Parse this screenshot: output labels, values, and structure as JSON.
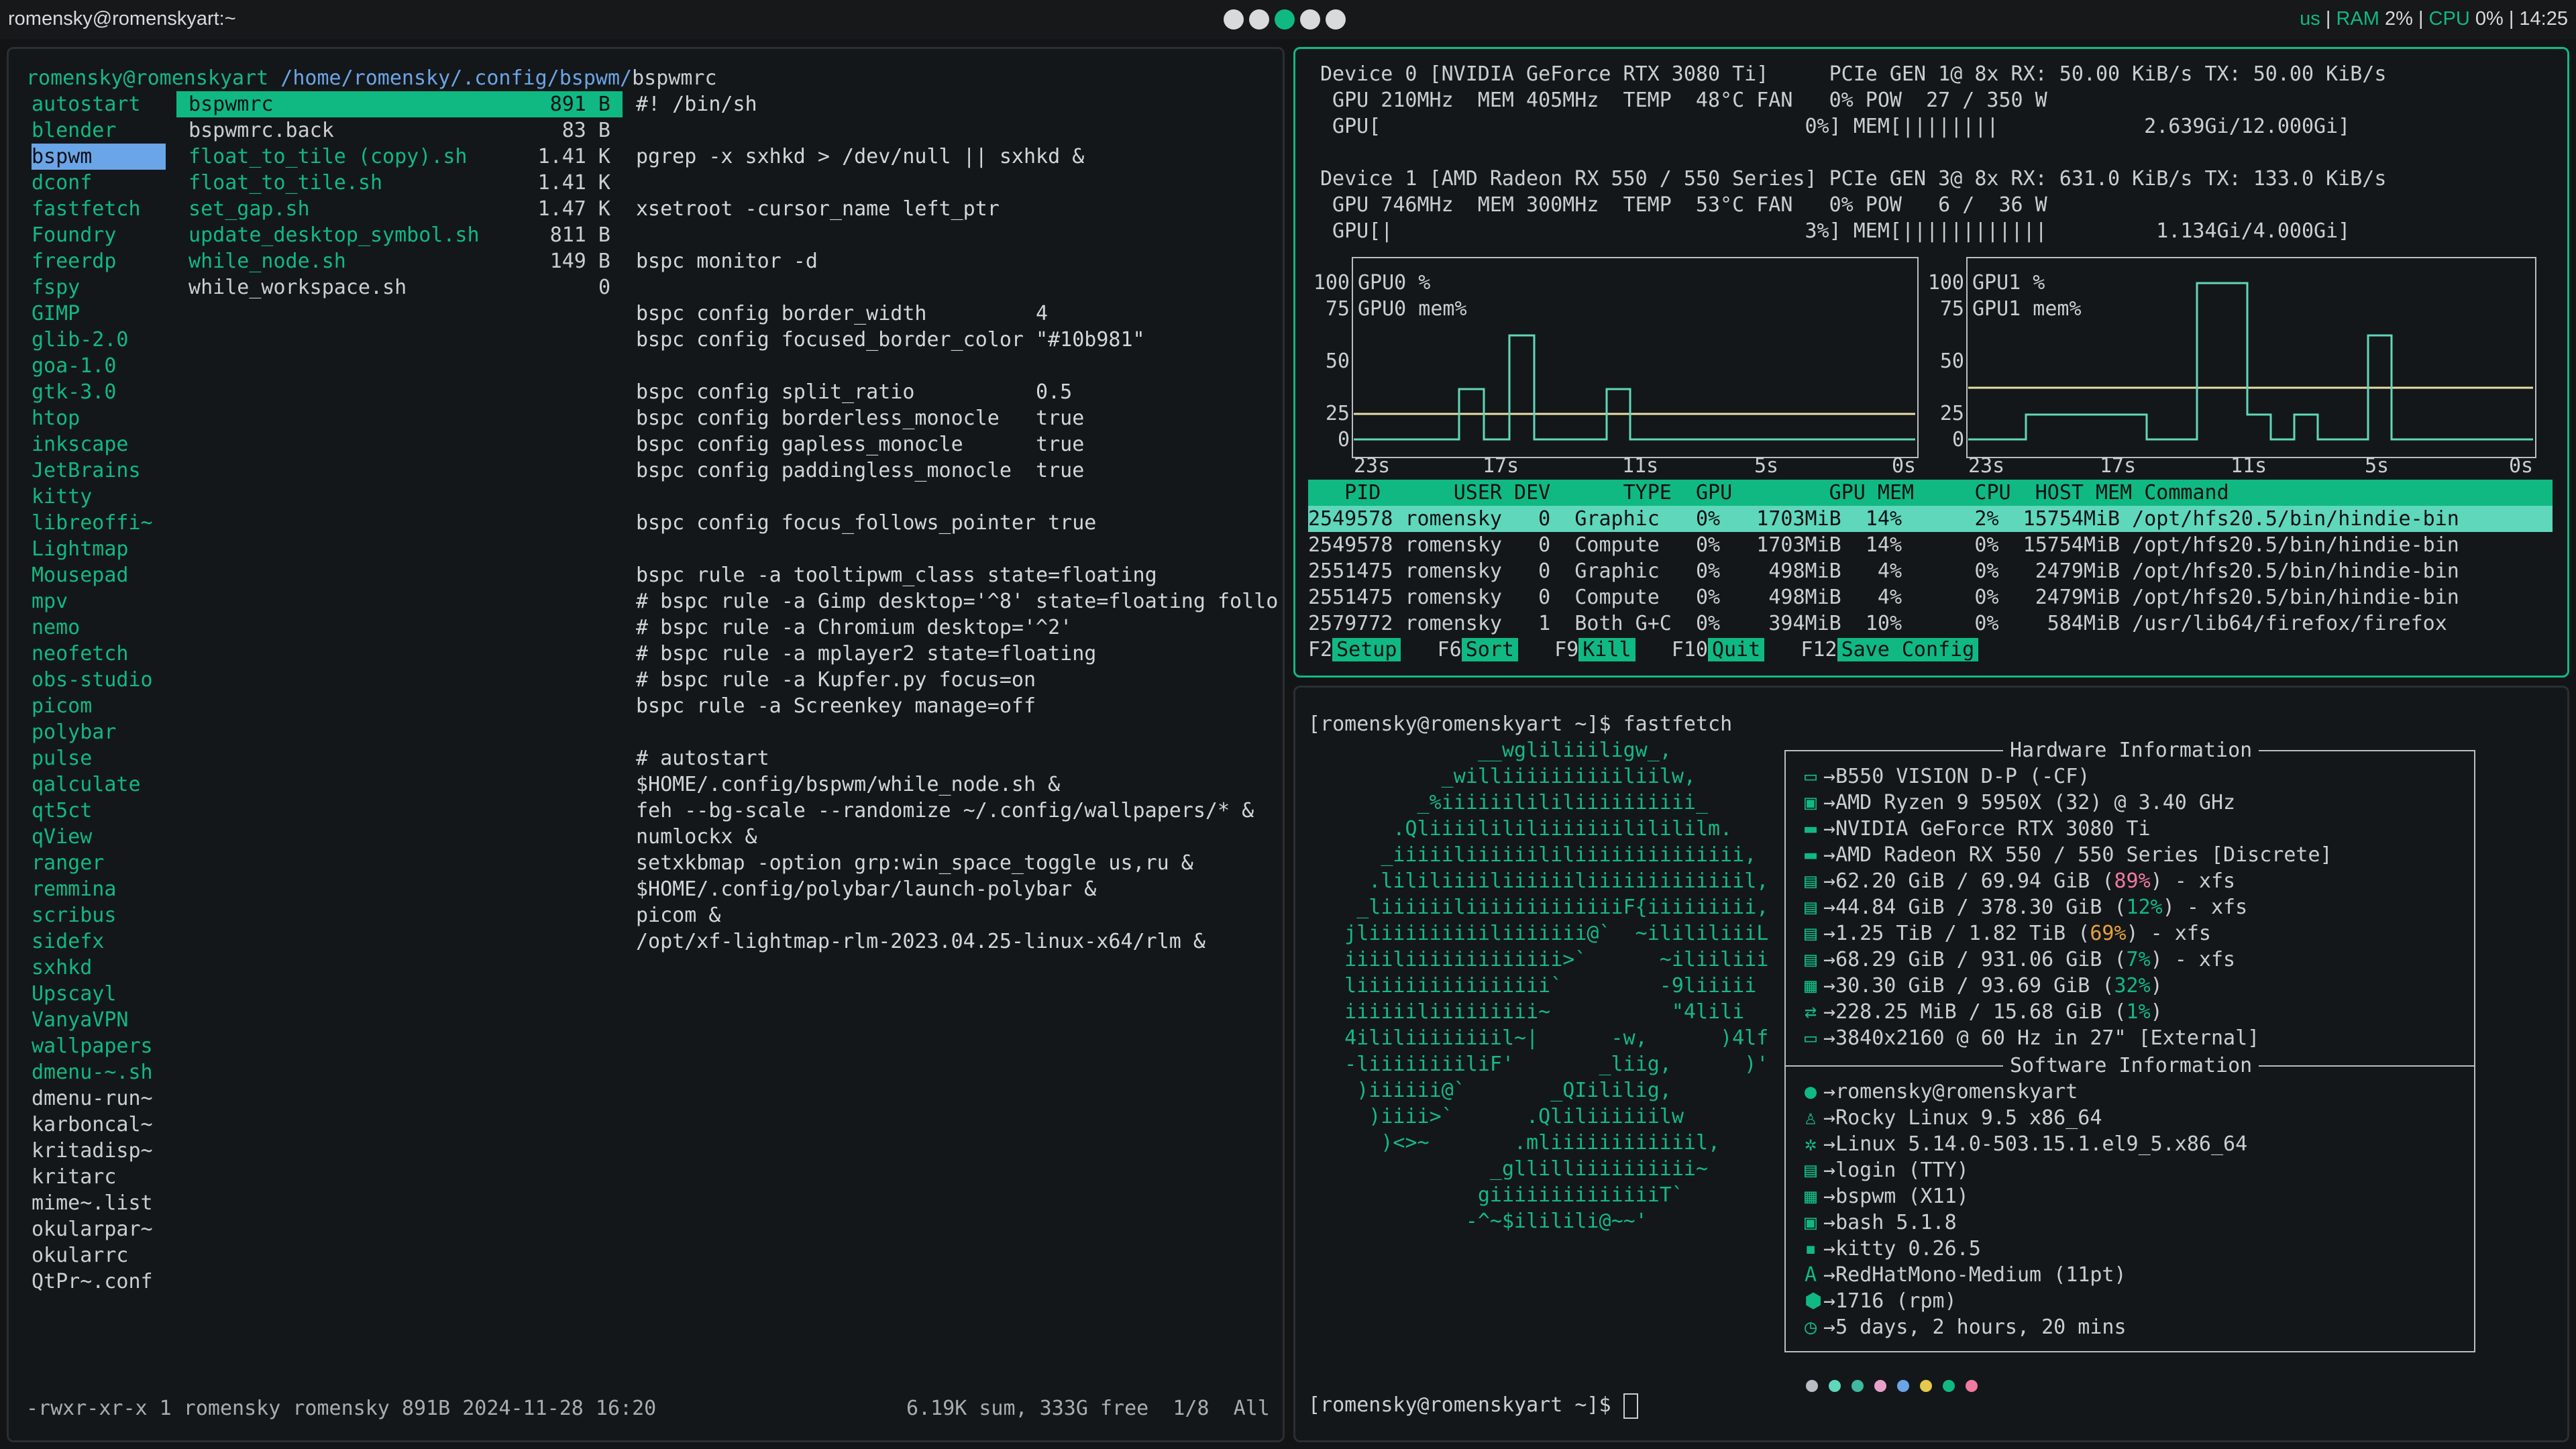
{
  "topbar": {
    "window_title": "romensky@romenskyart:~",
    "layout": "us",
    "ram_label": "RAM",
    "ram_value": "2%",
    "cpu_label": "CPU",
    "cpu_value": "0%",
    "clock": "14:25",
    "workspaces": [
      "1",
      "2",
      "3",
      "4",
      "5"
    ],
    "active_workspace": "3"
  },
  "ranger": {
    "path_user": "romensky@romenskyart",
    "path_dir": "/home/romensky/.config/bspwm/",
    "path_file": "bspwmrc",
    "dirs": [
      "autostart",
      "blender",
      "bspwm",
      "dconf",
      "fastfetch",
      "Foundry",
      "freerdp",
      "fspy",
      "GIMP",
      "glib-2.0",
      "goa-1.0",
      "gtk-3.0",
      "htop",
      "inkscape",
      "JetBrains",
      "kitty",
      "libreoffi~",
      "Lightmap",
      "Mousepad",
      "mpv",
      "nemo",
      "neofetch",
      "obs-studio",
      "picom",
      "polybar",
      "pulse",
      "qalculate",
      "qt5ct",
      "qView",
      "ranger",
      "remmina",
      "scribus",
      "sidefx",
      "sxhkd",
      "Upscayl",
      "VanyaVPN",
      "wallpapers",
      "dmenu-~.sh",
      "dmenu-run~",
      "karboncal~",
      "kritadisp~",
      "kritarc",
      "mime~.list",
      "okularpar~",
      "okularrc",
      "QtPr~.conf"
    ],
    "files": [
      {
        "name": "bspwmrc",
        "size": "891 B"
      },
      {
        "name": "bspwmrc.back",
        "size": "83 B"
      },
      {
        "name": "float_to_tile (copy).sh",
        "size": "1.41 K"
      },
      {
        "name": "float_to_tile.sh",
        "size": "1.41 K"
      },
      {
        "name": "set_gap.sh",
        "size": "1.47 K"
      },
      {
        "name": "update_desktop_symbol.sh",
        "size": "811 B"
      },
      {
        "name": "while_node.sh",
        "size": "149 B"
      },
      {
        "name": "while_workspace.sh",
        "size": "0"
      }
    ],
    "preview": [
      "#! /bin/sh",
      "",
      "pgrep -x sxhkd > /dev/null || sxhkd &",
      "",
      "xsetroot -cursor_name left_ptr",
      "",
      "bspc monitor -d",
      "",
      "bspc config border_width         4",
      "bspc config focused_border_color \"#10b981\"",
      "",
      "bspc config split_ratio          0.5",
      "bspc config borderless_monocle   true",
      "bspc config gapless_monocle      true",
      "bspc config paddingless_monocle  true",
      "",
      "bspc config focus_follows_pointer true",
      "",
      "bspc rule -a tooltipwm_class state=floating",
      "# bspc rule -a Gimp desktop='^8' state=floating follo",
      "# bspc rule -a Chromium desktop='^2'",
      "# bspc rule -a mplayer2 state=floating",
      "# bspc rule -a Kupfer.py focus=on",
      "bspc rule -a Screenkey manage=off",
      "",
      "# autostart",
      "$HOME/.config/bspwm/while_node.sh &",
      "feh --bg-scale --randomize ~/.config/wallpapers/* &",
      "numlockx &",
      "setxkbmap -option grp:win_space_toggle us,ru &",
      "$HOME/.config/polybar/launch-polybar &",
      "picom &",
      "/opt/xf-lightmap-rlm-2023.04.25-linux-x64/rlm &"
    ],
    "status_left": "-rwxr-xr-x 1 romensky romensky 891B 2024-11-28 16:20",
    "status_right": "6.19K sum, 333G free  1/8  All"
  },
  "nvtop": {
    "dev0_line1": "Device 0 [NVIDIA GeForce RTX 3080 Ti]     PCIe GEN 1@ 8x RX: 50.00 KiB/s TX: 50.00 KiB/s",
    "dev0_line2": " GPU 210MHz  MEM 405MHz  TEMP  48°C FAN   0% POW  27 / 350 W",
    "dev0_line3": " GPU[                                   0%] MEM[||||||||            2.639Gi/12.000Gi]",
    "dev1_line1": "Device 1 [AMD Radeon RX 550 / 550 Series] PCIe GEN 3@ 8x RX: 631.0 KiB/s TX: 133.0 KiB/s",
    "dev1_line2": " GPU 746MHz  MEM 300MHz  TEMP  53°C FAN   0% POW   6 /  36 W",
    "dev1_line3": " GPU[|                                  3%] MEM[||||||||||||         1.134Gi/4.000Gi]",
    "graph0_l1": "GPU0 %",
    "graph0_l2": "GPU0 mem%",
    "graph1_l1": "GPU1 %",
    "graph1_l2": "GPU1 mem%",
    "y_ticks": [
      "100",
      "75",
      "50",
      "25",
      "0"
    ],
    "x_ticks": [
      "23s",
      "17s",
      "11s",
      "5s",
      "0s"
    ],
    "table_header": "   PID      USER DEV      TYPE  GPU        GPU MEM     CPU  HOST MEM Command",
    "rows": [
      "2549578 romensky   0  Graphic   0%   1703MiB  14%      2%  15754MiB /opt/hfs20.5/bin/hindie-bin",
      "2549578 romensky   0  Compute   0%   1703MiB  14%      0%  15754MiB /opt/hfs20.5/bin/hindie-bin",
      "2551475 romensky   0  Graphic   0%    498MiB   4%      0%   2479MiB /opt/hfs20.5/bin/hindie-bin",
      "2551475 romensky   0  Compute   0%    498MiB   4%      0%   2479MiB /opt/hfs20.5/bin/hindie-bin",
      "2579772 romensky   1  Both G+C  0%    394MiB  10%      0%    584MiB /usr/lib64/firefox/firefox"
    ],
    "fkeys": [
      {
        "key": "F2",
        "label": "Setup"
      },
      {
        "key": "F6",
        "label": "Sort"
      },
      {
        "key": "F9",
        "label": "Kill"
      },
      {
        "key": "F10",
        "label": "Quit"
      },
      {
        "key": "F12",
        "label": "Save Config"
      }
    ]
  },
  "fastfetch": {
    "prompt": "[romensky@romenskyart ~]$ fastfetch",
    "ascii": [
      "              __wgliliiiligw_,",
      "           _williiiiiiiiiiliilw,",
      "         _%iiiiiilililiiiiiiiiii_",
      "       .Qliiiilililiiiiiiililililm.",
      "      _iiiiiliiiiiililiiiiiiiiiiiiii,",
      "     .lililiiiiliiiiiiliiiiiiiiiiiiil,",
      "    _liiiiiiliiiiiiiiiiiiiF{iiiiiiiii,",
      "   jliiiiiiiiiiliiiiiii@`  ~ilililiiiL",
      "   iiiiliiiiiiiiiiiii>`      ~iliiliii",
      "   liiiiiiiiiiiiiiii`        -9liiiii",
      "   iiiiiiliiiiiiiii~          \"4lili",
      "   4ililiiiiiiiil~|      -w,      )4lf",
      "   -liiiiiiiiliF'       _liig,      )'",
      "    )iiiiii@`       _QIililig,",
      "     )iiii>`      .Qliliiiiiilw",
      "      )<>~       .mliiiiiiiiiiiil,",
      "               _gllilliiiiiiiiii~",
      "              giiiiiiiiiiiiiiT`",
      "             -^~$ililili@~~'"
    ],
    "hw_title": "Hardware Information",
    "sw_title": "Software Information",
    "hw": [
      {
        "icon": "▭",
        "text": "B550 VISION D-P (-CF)"
      },
      {
        "icon": "▣",
        "text": "AMD Ryzen 9 5950X (32) @ 3.40 GHz"
      },
      {
        "icon": "▬",
        "text": "NVIDIA GeForce RTX 3080 Ti"
      },
      {
        "icon": "▬",
        "text": "AMD Radeon RX 550 / 550 Series [Discrete]"
      },
      {
        "icon": "▤",
        "text": "62.20 GiB / 69.94 GiB (",
        "pct": "89%",
        "tail": ") - xfs"
      },
      {
        "icon": "▤",
        "text": "44.84 GiB / 378.30 GiB (",
        "pct": "12%",
        "tail": ") - xfs"
      },
      {
        "icon": "▤",
        "text": "1.25 TiB / 1.82 TiB (",
        "pct": "69%",
        "tail": ") - xfs"
      },
      {
        "icon": "▤",
        "text": "68.29 GiB / 931.06 GiB (",
        "pct": "7%",
        "tail": ") - xfs"
      },
      {
        "icon": "▦",
        "text": "30.30 GiB / 93.69 GiB (",
        "pct": "32%",
        "tail": ")"
      },
      {
        "icon": "⇄",
        "text": "228.25 MiB / 15.68 GiB (",
        "pct": "1%",
        "tail": ")"
      },
      {
        "icon": "▭",
        "text": "3840x2160 @ 60 Hz in 27\" [External]"
      }
    ],
    "sw": [
      {
        "icon": "●",
        "text": "romensky@romenskyart"
      },
      {
        "icon": "♙",
        "text": "Rocky Linux 9.5 x86_64"
      },
      {
        "icon": "✲",
        "text": "Linux 5.14.0-503.15.1.el9_5.x86_64"
      },
      {
        "icon": "▤",
        "text": "login (TTY)"
      },
      {
        "icon": "▦",
        "text": "bspwm (X11)"
      },
      {
        "icon": "▣",
        "text": "bash 5.1.8"
      },
      {
        "icon": "▪",
        "text": "kitty 0.26.5"
      },
      {
        "icon": "A",
        "text": "RedHatMono-Medium (11pt)"
      },
      {
        "icon": "⬢",
        "text": "1716 (rpm)"
      },
      {
        "icon": "◷",
        "text": "5 days, 2 hours, 20 mins"
      }
    ],
    "arrow": "→",
    "palette": [
      "#b8bec3",
      "#5fd7bb",
      "#3fb8a0",
      "#e8a0c8",
      "#6aa5e8",
      "#e6c84c",
      "#10b981",
      "#f07aa0"
    ],
    "prompt2": "[romensky@romenskyart ~]$ "
  }
}
